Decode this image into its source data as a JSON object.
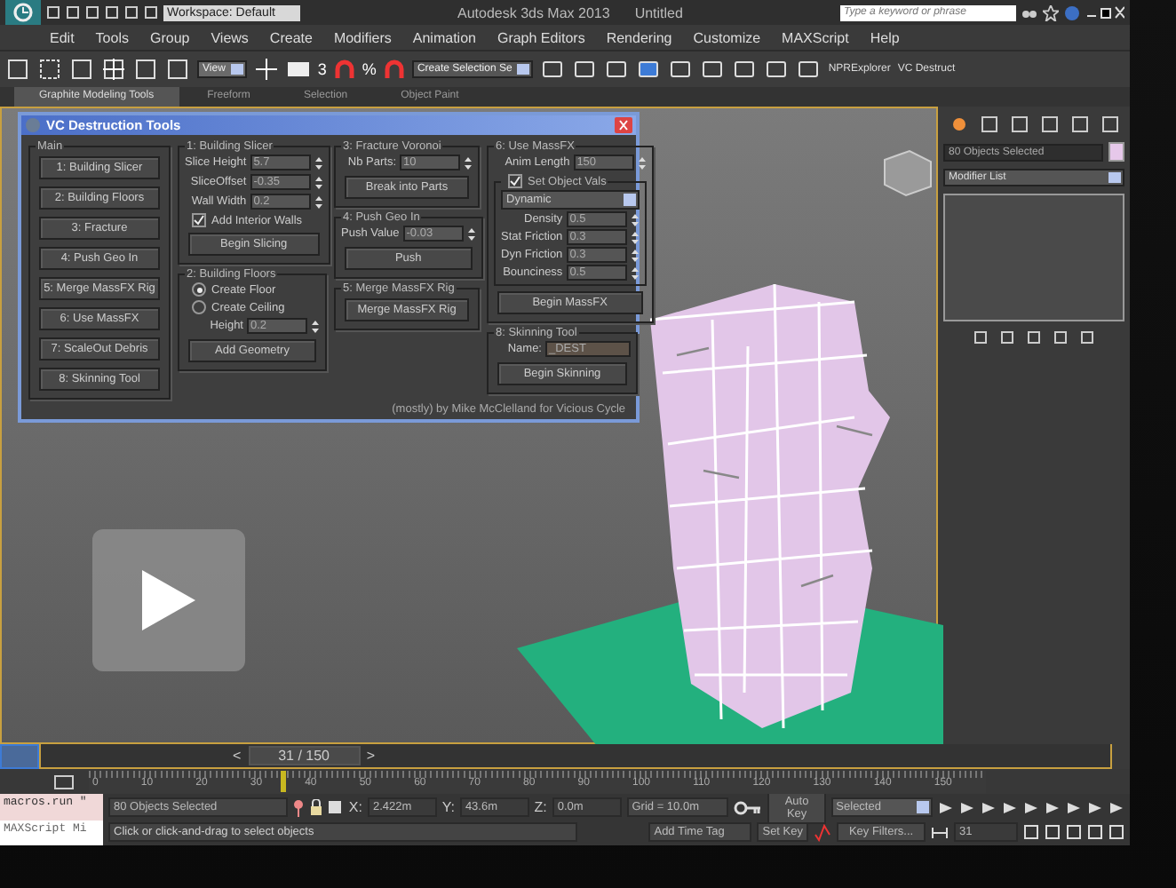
{
  "title_bar": {
    "workspace": "Workspace: Default",
    "app_title": "Autodesk 3ds Max 2013",
    "file_name": "Untitled",
    "search": {
      "placeholder": "Type a keyword or phrase"
    }
  },
  "menu": [
    "Edit",
    "Tools",
    "Group",
    "Views",
    "Create",
    "Modifiers",
    "Animation",
    "Graph Editors",
    "Rendering",
    "Customize",
    "MAXScript",
    "Help"
  ],
  "toolbar": {
    "view_dropdown": "View",
    "snap_label": "3",
    "percent_label": "%",
    "selection_set": "Create Selection Se",
    "labels": [
      "NPRExplorer",
      "VC Destruct"
    ]
  },
  "ribbon_tabs": [
    {
      "label": "Graphite Modeling Tools",
      "selected": true
    },
    {
      "label": "Freeform",
      "selected": false
    },
    {
      "label": "Selection",
      "selected": false
    },
    {
      "label": "Object Paint",
      "selected": false
    }
  ],
  "dialog": {
    "title": "VC Destruction Tools",
    "columns": [
      [
        {
          "title": "Main",
          "items": [
            {
              "kind": "button",
              "label": "1: Building Slicer"
            },
            {
              "kind": "button",
              "label": "2: Building Floors"
            },
            {
              "kind": "button",
              "label": "3: Fracture"
            },
            {
              "kind": "button",
              "label": "4: Push Geo In"
            },
            {
              "kind": "button",
              "label": "5: Merge MassFX Rig"
            },
            {
              "kind": "button",
              "label": "6: Use MassFX"
            },
            {
              "kind": "button",
              "label": "7: ScaleOut Debris"
            },
            {
              "kind": "button",
              "label": "8: Skinning Tool"
            }
          ]
        }
      ],
      [
        {
          "title": "1: Building Slicer",
          "items": [
            {
              "kind": "spinner",
              "label": "Slice Height",
              "value": "5.7"
            },
            {
              "kind": "spinner",
              "label": "SliceOffset",
              "value": "-0.35"
            },
            {
              "kind": "spinner",
              "label": "Wall Width",
              "value": "0.2"
            },
            {
              "kind": "checkbox",
              "label": "Add Interior Walls",
              "checked": true
            },
            {
              "kind": "button",
              "label": "Begin Slicing"
            }
          ]
        },
        {
          "title": "2: Building Floors",
          "items": [
            {
              "kind": "radio",
              "label": "Create Floor",
              "selected": true
            },
            {
              "kind": "radio",
              "label": "Create Ceiling",
              "selected": false
            },
            {
              "kind": "spinner",
              "label": "Height",
              "value": "0.2"
            },
            {
              "kind": "button",
              "label": "Add Geometry"
            }
          ]
        }
      ],
      [
        {
          "title": "3: Fracture Voronoi",
          "items": [
            {
              "kind": "spinner",
              "label": "Nb Parts:",
              "value": "10"
            },
            {
              "kind": "button",
              "label": "Break into Parts"
            }
          ]
        },
        {
          "title": "4: Push Geo In",
          "items": [
            {
              "kind": "spinner",
              "label": "Push Value",
              "value": "-0.03"
            },
            {
              "kind": "button",
              "label": "Push"
            }
          ]
        },
        {
          "title": "5: Merge MassFX Rig",
          "items": [
            {
              "kind": "button",
              "label": "Merge MassFX Rig"
            }
          ]
        }
      ],
      [
        {
          "title": "6: Use MassFX",
          "items": [
            {
              "kind": "spinner",
              "label": "Anim Length",
              "value": "150"
            },
            {
              "kind": "subgroup",
              "label": "Set Object Vals",
              "checked": true,
              "items": [
                {
                  "kind": "dropdown",
                  "value": "Dynamic"
                },
                {
                  "kind": "spinner",
                  "label": "Density",
                  "value": "0.5"
                },
                {
                  "kind": "spinner",
                  "label": "Stat Friction",
                  "value": "0.3"
                },
                {
                  "kind": "spinner",
                  "label": "Dyn Friction",
                  "value": "0.3"
                },
                {
                  "kind": "spinner",
                  "label": "Bounciness",
                  "value": "0.5"
                }
              ]
            },
            {
              "kind": "button",
              "label": "Begin MassFX"
            }
          ]
        },
        {
          "title": "8: Skinning Tool",
          "items": [
            {
              "kind": "text",
              "label": "Name:",
              "value": "_DEST"
            },
            {
              "kind": "button",
              "label": "Begin Skinning"
            }
          ]
        }
      ]
    ],
    "credit": "(mostly) by Mike McClelland for Vicious Cycle"
  },
  "command_panel": {
    "selection": "80 Objects Selected",
    "color": "#e6c8ea",
    "modifier_list": "Modifier List"
  },
  "time_slider": {
    "label": "31 / 150",
    "prev": "<",
    "next": ">"
  },
  "trackbar": {
    "level": 0.207,
    "ticks": [
      "0",
      "10",
      "20",
      "30",
      "40",
      "50",
      "60",
      "70",
      "80",
      "90",
      "100",
      "110",
      "120",
      "130",
      "140",
      "150"
    ]
  },
  "status": {
    "listener": [
      "macros.run \"",
      "MAXScript Mi"
    ],
    "selection": "80 Objects Selected",
    "prompt": "Click or click-and-drag to select objects",
    "coords": [
      {
        "axis": "X:",
        "value": "2.422m"
      },
      {
        "axis": "Y:",
        "value": "43.6m"
      },
      {
        "axis": "Z:",
        "value": "0.0m"
      }
    ],
    "grid": "Grid = 10.0m",
    "time_tag": "Add Time Tag",
    "auto_key": "Auto Key",
    "key_mode": "Selected",
    "set_key": "Set Key",
    "key_filters": "Key Filters...",
    "frame": "31"
  }
}
